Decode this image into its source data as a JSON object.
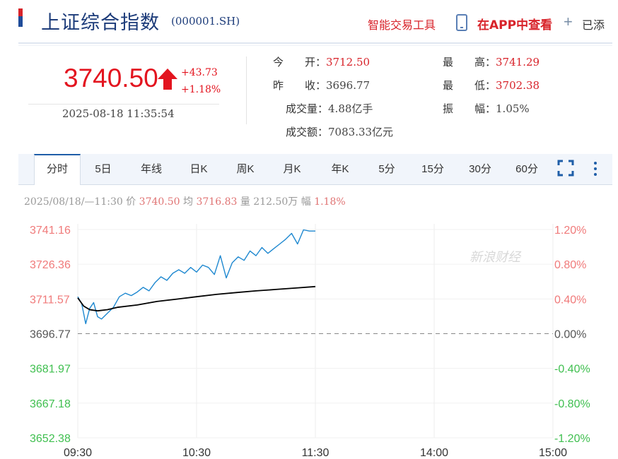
{
  "header": {
    "title": "上证综合指数",
    "code": "(000001.SH)",
    "tools_label": "智能交易工具",
    "app_label": "在APP中查看",
    "add_label": "已添"
  },
  "quote": {
    "price": "3740.50",
    "change": "+43.73",
    "change_pct": "+1.18%",
    "datetime": "2025-08-18  11:35:54"
  },
  "stats": [
    {
      "label": "今　　开：",
      "value": "3712.50",
      "color": "red"
    },
    {
      "label": "最　　高：",
      "value": "3741.29",
      "color": "red"
    },
    {
      "label": "昨　　收：",
      "value": "3696.77",
      "color": "gray"
    },
    {
      "label": "最　　低：",
      "value": "3702.38",
      "color": "red"
    },
    {
      "label": "成交量：",
      "value": "4.88亿手",
      "color": "gray"
    },
    {
      "label": "振　　幅：",
      "value": "1.05%",
      "color": "gray"
    },
    {
      "label": "成交额：",
      "value": "7083.33亿元",
      "color": "gray"
    }
  ],
  "tabs": [
    "分时",
    "5日",
    "年线",
    "日K",
    "周K",
    "月K",
    "年K",
    "5分",
    "15分",
    "30分",
    "60分"
  ],
  "active_tab": "分时",
  "infoline": {
    "date": "2025/08/18/—11:30",
    "price_label": "价",
    "price": "3740.50",
    "avg_label": "均",
    "avg": "3716.83",
    "vol_label": "量",
    "vol": "212.50万",
    "amp_label": "幅",
    "amp": "1.18%"
  },
  "watermark": "新浪财经",
  "colors": {
    "up": "#e3141f",
    "down": "#2db33c",
    "price_line": "#1e88d0",
    "avg_line": "#000000",
    "title": "#1d3c7a"
  },
  "chart_data": {
    "type": "line",
    "y_left_ticks": [
      "3741.16",
      "3726.36",
      "3711.57",
      "3696.77",
      "3681.97",
      "3667.18",
      "3652.38"
    ],
    "y_right_ticks": [
      "1.20%",
      "0.80%",
      "0.40%",
      "0.00%",
      "-0.40%",
      "-0.80%",
      "-1.20%"
    ],
    "x_ticks": [
      "09:30",
      "10:30",
      "11:30",
      "14:00",
      "15:00"
    ],
    "ylim": [
      3652.38,
      3741.16
    ],
    "baseline": 3696.77,
    "grid": true,
    "series": [
      {
        "name": "价",
        "x": [
          0,
          2,
          4,
          6,
          8,
          10,
          12,
          15,
          18,
          21,
          24,
          27,
          30,
          33,
          36,
          39,
          42,
          45,
          48,
          51,
          54,
          57,
          60,
          63,
          66,
          69,
          72,
          75,
          78,
          81,
          84,
          87,
          90,
          93,
          96,
          99,
          102,
          105,
          108,
          111,
          114,
          117,
          120
        ],
        "values": [
          3712.5,
          3709.5,
          3701.0,
          3707.5,
          3710.0,
          3704.0,
          3703.0,
          3705.5,
          3708.0,
          3712.5,
          3714.0,
          3713.0,
          3714.5,
          3716.5,
          3715.0,
          3718.5,
          3721.0,
          3719.5,
          3722.5,
          3724.0,
          3722.5,
          3725.0,
          3723.0,
          3726.0,
          3725.0,
          3722.0,
          3730.0,
          3720.5,
          3727.0,
          3729.5,
          3728.0,
          3732.0,
          3730.0,
          3733.5,
          3731.0,
          3733.0,
          3735.0,
          3737.0,
          3739.5,
          3735.0,
          3741.0,
          3740.5,
          3740.5
        ]
      },
      {
        "name": "均",
        "x": [
          0,
          3,
          6,
          10,
          15,
          20,
          30,
          40,
          50,
          60,
          70,
          80,
          90,
          100,
          110,
          120
        ],
        "values": [
          3712.0,
          3708.5,
          3707.0,
          3706.5,
          3707.0,
          3708.0,
          3709.0,
          3710.5,
          3711.5,
          3712.5,
          3713.5,
          3714.3,
          3715.0,
          3715.6,
          3716.2,
          3716.83
        ]
      }
    ]
  }
}
